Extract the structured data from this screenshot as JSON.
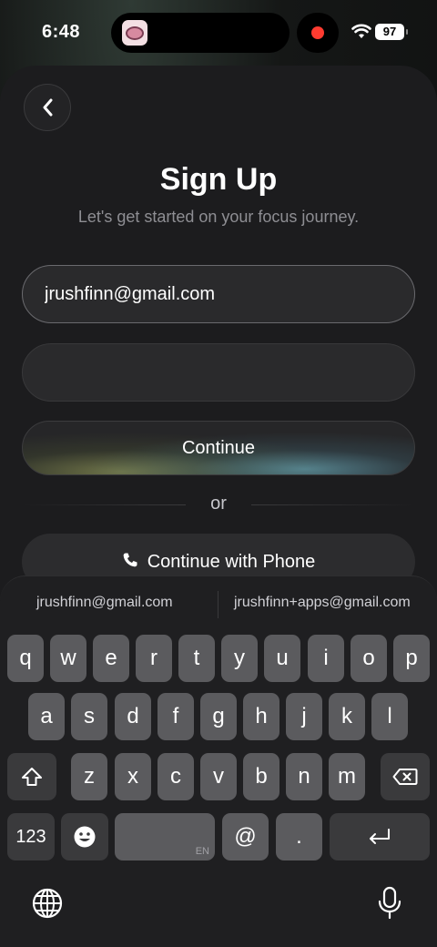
{
  "status_bar": {
    "time": "6:48",
    "battery": "97"
  },
  "header": {
    "title": "Sign Up",
    "subtitle": "Let's get started on your focus journey."
  },
  "form": {
    "email_value": "jrushfinn@gmail.com",
    "password_value": "",
    "continue_label": "Continue",
    "divider_label": "or",
    "phone_label": "Continue with Phone"
  },
  "keyboard": {
    "suggestions": [
      "jrushfinn@gmail.com",
      "jrushfinn+apps@gmail.com"
    ],
    "row1": [
      "q",
      "w",
      "e",
      "r",
      "t",
      "y",
      "u",
      "i",
      "o",
      "p"
    ],
    "row2": [
      "a",
      "s",
      "d",
      "f",
      "g",
      "h",
      "j",
      "k",
      "l"
    ],
    "row3": [
      "z",
      "x",
      "c",
      "v",
      "b",
      "n",
      "m"
    ],
    "numbers_label": "123",
    "space_lang": "EN",
    "at_label": "@",
    "dot_label": "."
  },
  "colors": {
    "record": "#ff3b30",
    "background": "#1c1c1e",
    "key": "#5b5b5e"
  },
  "icons": [
    "back-chevron-icon",
    "wifi-icon",
    "phone-icon",
    "shift-icon",
    "delete-icon",
    "emoji-icon",
    "return-icon",
    "globe-icon",
    "microphone-icon"
  ]
}
